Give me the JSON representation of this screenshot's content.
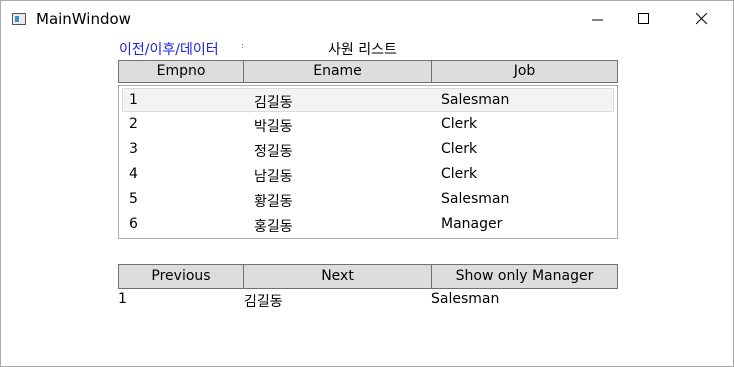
{
  "window": {
    "title": "MainWindow"
  },
  "nav_label": "이전/이후/데이터",
  "nav_separator": ":",
  "page_title": "사원 리스트",
  "columns": [
    "Empno",
    "Ename",
    "Job"
  ],
  "employees": [
    {
      "empno": "1",
      "ename": "김길동",
      "job": "Salesman"
    },
    {
      "empno": "2",
      "ename": "박길동",
      "job": "Clerk"
    },
    {
      "empno": "3",
      "ename": "정길동",
      "job": "Clerk"
    },
    {
      "empno": "4",
      "ename": "남길동",
      "job": "Clerk"
    },
    {
      "empno": "5",
      "ename": "황길동",
      "job": "Salesman"
    },
    {
      "empno": "6",
      "ename": "홍길동",
      "job": "Manager"
    }
  ],
  "selected_index": 0,
  "buttons": {
    "previous": "Previous",
    "next": "Next",
    "show_manager": "Show only Manager"
  },
  "current": {
    "empno": "1",
    "ename": "김길동",
    "job": "Salesman"
  }
}
